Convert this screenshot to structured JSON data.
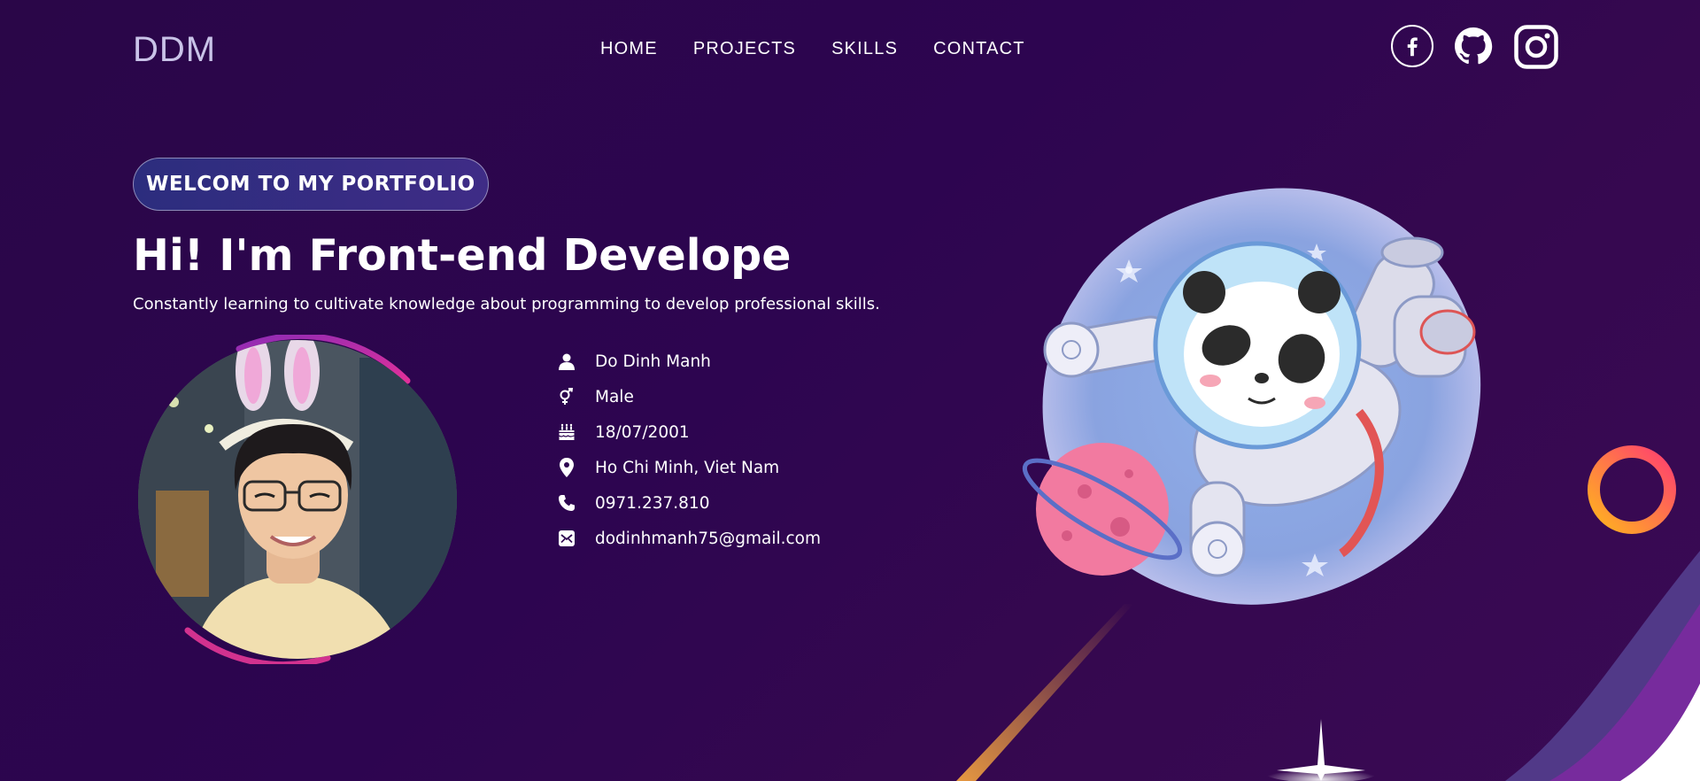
{
  "nav": {
    "logo": "DDM",
    "links": [
      "HOME",
      "PROJECTS",
      "SKILLS",
      "CONTACT"
    ],
    "social": [
      "facebook-icon",
      "github-icon",
      "instagram-icon"
    ]
  },
  "hero": {
    "badge": "WELCOM TO MY PORTFOLIO",
    "title": "Hi! I'm Front-end Develope",
    "subtitle": "Constantly learning to cultivate knowledge about programming to develop professional skills."
  },
  "info": [
    {
      "icon": "user-icon",
      "text": "Do Dinh Manh"
    },
    {
      "icon": "gender-icon",
      "text": "Male"
    },
    {
      "icon": "birthday-cake-icon",
      "text": "18/07/2001"
    },
    {
      "icon": "location-pin-icon",
      "text": "Ho Chi Minh, Viet Nam"
    },
    {
      "icon": "phone-icon",
      "text": "0971.237.810"
    },
    {
      "icon": "email-icon",
      "text": "dodinhmanh75@gmail.com"
    }
  ],
  "colors": {
    "background": "#2d0550",
    "badge": "#2c2d7e",
    "avatar_ring": "#c2369a",
    "ring_gradient_start": "#ff3d6e",
    "ring_gradient_end": "#ffb020",
    "logo": "#c9c3e8"
  }
}
